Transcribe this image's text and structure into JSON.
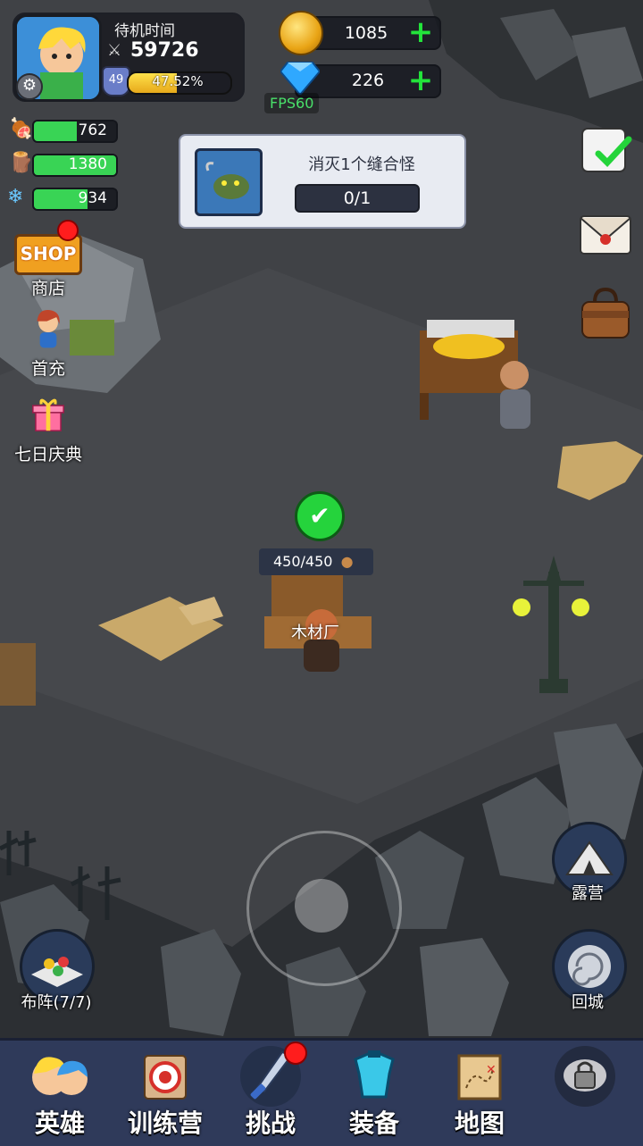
{
  "profile": {
    "idle_label": "待机时间",
    "power": "59726",
    "level": "49",
    "xp_percent": "47.52%",
    "xp_fraction": 0.4752
  },
  "currency": {
    "gold": "1085",
    "gems": "226",
    "fps": "FPS60"
  },
  "resources": [
    {
      "icon": "meat-icon",
      "value": "762",
      "fill": 0.8
    },
    {
      "icon": "wood-icon",
      "value": "1380",
      "fill": 0.8
    },
    {
      "icon": "crystal-icon",
      "value": "934",
      "fill": 0.8
    }
  ],
  "left_menu": {
    "shop_badge": "SHOP",
    "shop": "商店",
    "first_recharge": "首充",
    "seven_day": "七日庆典"
  },
  "quest": {
    "title": "消灭1个缝合怪",
    "progress": "0/1"
  },
  "world": {
    "production": "450/450",
    "building_name": "木材厂"
  },
  "buttons": {
    "camp": "露营",
    "formation": "布阵(7/7)",
    "return_city": "回城"
  },
  "tabs": [
    {
      "label": "英雄",
      "icon": "heroes-icon"
    },
    {
      "label": "训练营",
      "icon": "training-target-icon"
    },
    {
      "label": "挑战",
      "icon": "sword-icon"
    },
    {
      "label": "装备",
      "icon": "armor-icon"
    },
    {
      "label": "地图",
      "icon": "map-icon"
    },
    {
      "label": "",
      "icon": "locked-icon"
    }
  ]
}
